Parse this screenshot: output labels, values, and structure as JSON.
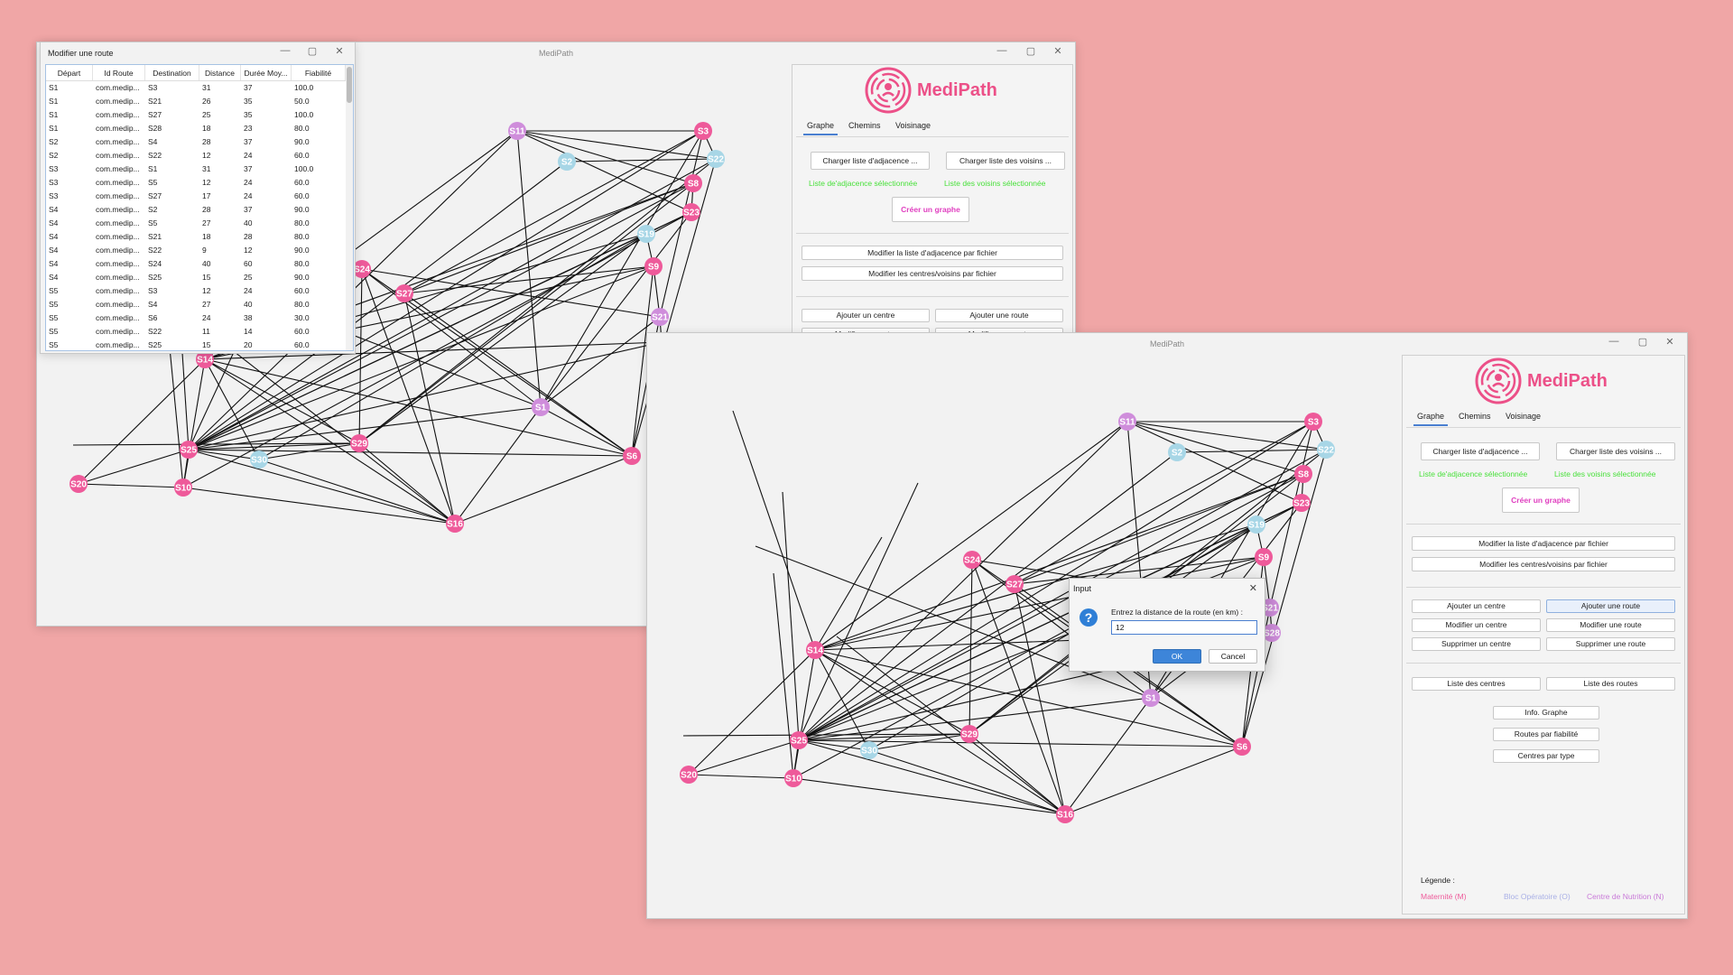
{
  "app": {
    "title": "MediPath",
    "logo_text": "MediPath",
    "tabs": [
      "Graphe",
      "Chemins",
      "Voisinage"
    ],
    "buttons": {
      "load_adjacency": "Charger liste d'adjacence ...",
      "load_neighbors": "Charger liste des voisins ...",
      "create_graph": "Créer un graphe",
      "modify_adjacency_file": "Modifier la liste d'adjacence par fichier",
      "modify_centers_file": "Modifier les centres/voisins par fichier",
      "add_center": "Ajouter un centre",
      "add_route": "Ajouter une route",
      "modify_center": "Modifier un centre",
      "modify_route": "Modifier une route",
      "delete_center": "Supprimer un centre",
      "delete_route": "Supprimer une route",
      "list_centers": "Liste des centres",
      "list_routes": "Liste des routes",
      "graph_info": "Info. Graphe",
      "routes_reliability": "Routes par fiabilité",
      "centers_type": "Centres par type"
    },
    "status": {
      "adjacency_selected": "Liste de'adjacence sélectionnée",
      "neighbors_selected": "Liste des voisins sélectionnée"
    },
    "legend": {
      "title": "Légende :",
      "maternity": "Maternité (M)",
      "surgery": "Bloc Opératoire (O)",
      "nutrition": "Centre de Nutrition (N)",
      "colors": {
        "maternity": "#ee5a9a",
        "surgery": "#a9b0e6",
        "nutrition": "#c97ad8"
      }
    }
  },
  "node_colors": {
    "pink": "#ee5a9a",
    "purple": "#cf8ddb",
    "blue": "#a7d6e6",
    "edge": "#111111"
  },
  "graph": {
    "nodes": [
      {
        "id": "S11",
        "color": "purple"
      },
      {
        "id": "S3",
        "color": "pink"
      },
      {
        "id": "S2",
        "color": "blue"
      },
      {
        "id": "S22",
        "color": "blue"
      },
      {
        "id": "S8",
        "color": "pink"
      },
      {
        "id": "S23",
        "color": "pink"
      },
      {
        "id": "S19",
        "color": "blue"
      },
      {
        "id": "S9",
        "color": "pink"
      },
      {
        "id": "S27",
        "color": "pink"
      },
      {
        "id": "S21",
        "color": "purple"
      },
      {
        "id": "S28",
        "color": "purple"
      },
      {
        "id": "S14",
        "color": "pink"
      },
      {
        "id": "S1",
        "color": "purple"
      },
      {
        "id": "S25",
        "color": "pink"
      },
      {
        "id": "S30",
        "color": "blue"
      },
      {
        "id": "S29",
        "color": "pink"
      },
      {
        "id": "S6",
        "color": "pink"
      },
      {
        "id": "S20",
        "color": "pink"
      },
      {
        "id": "S10",
        "color": "pink"
      },
      {
        "id": "S16",
        "color": "pink"
      },
      {
        "id": "S24",
        "color": "pink"
      }
    ]
  },
  "route_window": {
    "title": "Modifier une route",
    "columns": [
      "Départ",
      "Id Route",
      "Destination",
      "Distance",
      "Durée Moy...",
      "Fiabilité"
    ],
    "rows": [
      [
        "S1",
        "com.medip...",
        "S3",
        "31",
        "37",
        "100.0"
      ],
      [
        "S1",
        "com.medip...",
        "S21",
        "26",
        "35",
        "50.0"
      ],
      [
        "S1",
        "com.medip...",
        "S27",
        "25",
        "35",
        "100.0"
      ],
      [
        "S1",
        "com.medip...",
        "S28",
        "18",
        "23",
        "80.0"
      ],
      [
        "S2",
        "com.medip...",
        "S4",
        "28",
        "37",
        "90.0"
      ],
      [
        "S2",
        "com.medip...",
        "S22",
        "12",
        "24",
        "60.0"
      ],
      [
        "S3",
        "com.medip...",
        "S1",
        "31",
        "37",
        "100.0"
      ],
      [
        "S3",
        "com.medip...",
        "S5",
        "12",
        "24",
        "60.0"
      ],
      [
        "S3",
        "com.medip...",
        "S27",
        "17",
        "24",
        "60.0"
      ],
      [
        "S4",
        "com.medip...",
        "S2",
        "28",
        "37",
        "90.0"
      ],
      [
        "S4",
        "com.medip...",
        "S5",
        "27",
        "40",
        "80.0"
      ],
      [
        "S4",
        "com.medip...",
        "S21",
        "18",
        "28",
        "80.0"
      ],
      [
        "S4",
        "com.medip...",
        "S22",
        "9",
        "12",
        "90.0"
      ],
      [
        "S4",
        "com.medip...",
        "S24",
        "40",
        "60",
        "80.0"
      ],
      [
        "S4",
        "com.medip...",
        "S25",
        "15",
        "25",
        "90.0"
      ],
      [
        "S5",
        "com.medip...",
        "S3",
        "12",
        "24",
        "60.0"
      ],
      [
        "S5",
        "com.medip...",
        "S4",
        "27",
        "40",
        "80.0"
      ],
      [
        "S5",
        "com.medip...",
        "S6",
        "24",
        "38",
        "30.0"
      ],
      [
        "S5",
        "com.medip...",
        "S22",
        "11",
        "14",
        "60.0"
      ],
      [
        "S5",
        "com.medip...",
        "S25",
        "15",
        "20",
        "60.0"
      ]
    ]
  },
  "input_dialog": {
    "title": "Input",
    "prompt": "Entrez la distance de la route (en km) :",
    "value": "12",
    "ok": "OK",
    "cancel": "Cancel"
  }
}
